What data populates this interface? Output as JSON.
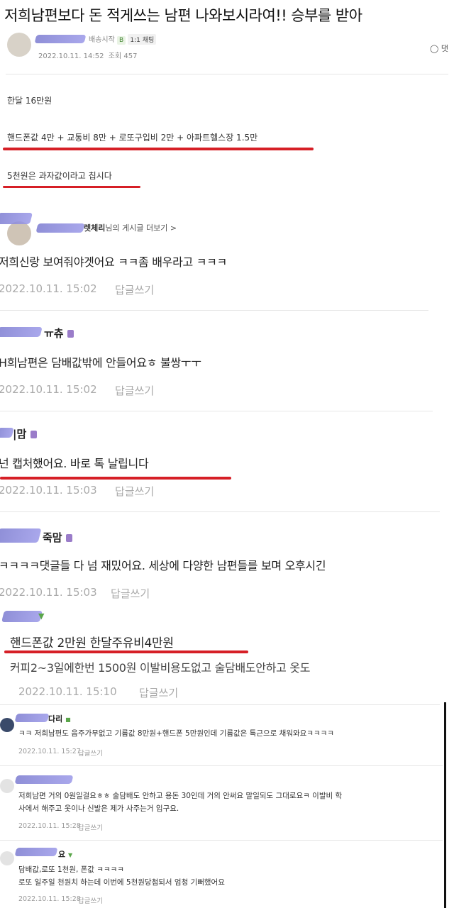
{
  "post": {
    "title": "저희남편보다 돈 적게쓰는 남편 나와보시라여!! 승부를 받아",
    "author_suffix": "배송시작",
    "level_badge": "B",
    "chat_badge": "1:1 채팅",
    "date": "2022.10.11. 14:52",
    "views_label": "조회",
    "views": "457",
    "comment_link": "댓",
    "lines": [
      "한달 16만원",
      "핸드폰값 4만 + 교통비 8만 + 로또구입비 2만 + 아파트헬스장 1.5만",
      "5천원은 과자값이라고 칩시다"
    ]
  },
  "author_more": {
    "name_suffix": "렛체리",
    "more_link": "님의 게시글 더보기 >"
  },
  "reply_label": "답글쓰기",
  "comments": [
    {
      "name": "",
      "text": "저희신랑 보여줘야겟어요 ㅋㅋ좀 배우라고 ㅋㅋㅋ",
      "date": "2022.10.11. 15:02"
    },
    {
      "name": "ㅠ츄",
      "text": "H희남편은 담배값밖에 안들어요ㅎ 불쌍ㅜㅜ",
      "date": "2022.10.11. 15:02"
    },
    {
      "name": "|맘",
      "text": "넌 캡처했어요. 바로 톡 날립니다",
      "date": "2022.10.11. 15:03"
    },
    {
      "name": "죽맘",
      "text": "ㅋㅋㅋㅋ댓글들 다 넘 재밌어요. 세상에 다양한 남편들를 보며 오후시긴",
      "date": "2022.10.11. 15:03"
    },
    {
      "name": "",
      "text": "핸드폰값 2만원 한달주유비4만원",
      "text2": "커피2~3일에한번 1500원 이발비용도없고 술담배도안하고 옷도",
      "date": "2022.10.11. 15:10"
    }
  ],
  "small_comments": [
    {
      "name": "다리",
      "lines": [
        "ㅋㅋ 저희남편도 음주가무없고 기름값 8만원+핸드폰 5만원인데 기름값은 특근으로 채워와요ㅋㅋㅋㅋ"
      ],
      "date": "2022.10.11. 15:27"
    },
    {
      "name": "",
      "lines": [
        "저희남편 거의 0원일걸요ㅎㅎ 술담배도 안하고 용돈 30인데 거의 안써요 말일되도 그대로요ㅋ 이발비 학",
        "사에서 해주고 옷이나 신발은 제가 사주는거 입구요."
      ],
      "date": "2022.10.11. 15:28"
    },
    {
      "name": "요",
      "lines": [
        "담배값,로또 1천원, 폰값 ㅋㅋㅋㅋ",
        "로또 일주일 천원치 하는데 이번에 5천원당첨되서 엄청 기뻐했어요"
      ],
      "date": "2022.10.11. 15:28"
    }
  ]
}
